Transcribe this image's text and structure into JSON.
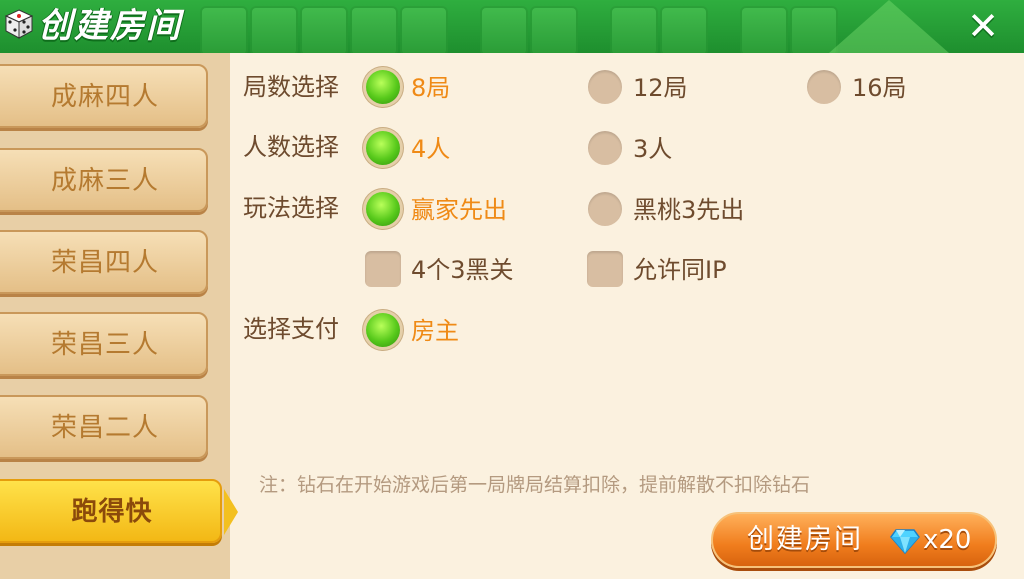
{
  "header": {
    "title": "创建房间",
    "close_label": "✕"
  },
  "sidebar": {
    "items": [
      {
        "label": "成麻四人"
      },
      {
        "label": "成麻三人"
      },
      {
        "label": "荣昌四人"
      },
      {
        "label": "荣昌三人"
      },
      {
        "label": "荣昌二人"
      },
      {
        "label": "跑得快",
        "selected": true
      }
    ]
  },
  "rounds": {
    "label": "局数选择",
    "options": [
      "8局",
      "12局",
      "16局"
    ],
    "selected": "8局"
  },
  "players": {
    "label": "人数选择",
    "options": [
      "4人",
      "3人"
    ],
    "selected": "4人"
  },
  "rules": {
    "label": "玩法选择",
    "options": [
      "赢家先出",
      "黑桃3先出"
    ],
    "selected": "赢家先出"
  },
  "extras": {
    "options": [
      "4个3黑关",
      "允许同IP"
    ],
    "checked": [
      false,
      false
    ]
  },
  "payment": {
    "label": "选择支付",
    "options": [
      "房主"
    ],
    "selected": "房主"
  },
  "note": "注：钻石在开始游戏后第一局牌局结算扣除，提前解散不扣除钻石",
  "create": {
    "label": "创建房间",
    "cost": "x20",
    "icon": "diamond-icon"
  },
  "colors": {
    "header": "#23a035",
    "selected_text": "#ef8a16",
    "label_text": "#6e4b2e",
    "panel": "#fbf1df"
  }
}
